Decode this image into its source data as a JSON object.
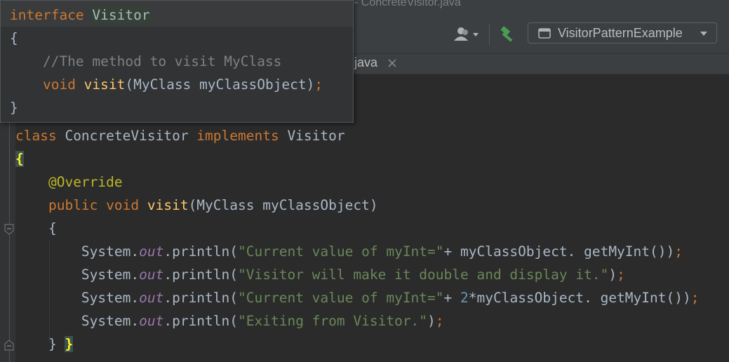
{
  "window": {
    "title_fragment": "- ConcreteVisitor.java"
  },
  "toolbar": {
    "run_config_label": "VisitorPatternExample"
  },
  "tabs": [
    {
      "label": ".java"
    }
  ],
  "popup": {
    "lines": [
      {
        "tokens": [
          {
            "t": "interface ",
            "c": "kw"
          },
          {
            "t": "Visitor",
            "c": "hl"
          }
        ]
      },
      {
        "tokens": [
          {
            "t": "{",
            "c": ""
          }
        ]
      },
      {
        "tokens": [
          {
            "t": "    //The method to visit MyClass",
            "c": "cmt"
          }
        ]
      },
      {
        "tokens": [
          {
            "t": "    ",
            "c": ""
          },
          {
            "t": "void ",
            "c": "kw"
          },
          {
            "t": "visit",
            "c": "fn"
          },
          {
            "t": "(MyClass myClassObject)",
            "c": ""
          },
          {
            "t": ";",
            "c": "kw"
          }
        ]
      },
      {
        "tokens": [
          {
            "t": "}",
            "c": ""
          }
        ]
      }
    ]
  },
  "code": {
    "lines": [
      {
        "tokens": [
          {
            "t": "class ",
            "c": "kw"
          },
          {
            "t": "ConcreteVisitor ",
            "c": ""
          },
          {
            "t": "implements ",
            "c": "kw"
          },
          {
            "t": "Visitor",
            "c": ""
          }
        ]
      },
      {
        "tokens": [
          {
            "t": "{",
            "c": "brace-hl"
          }
        ]
      },
      {
        "tokens": [
          {
            "t": "    ",
            "c": ""
          },
          {
            "t": "@Override",
            "c": "ann"
          }
        ]
      },
      {
        "tokens": [
          {
            "t": "    ",
            "c": ""
          },
          {
            "t": "public ",
            "c": "kw"
          },
          {
            "t": "void ",
            "c": "kw"
          },
          {
            "t": "visit",
            "c": "fn"
          },
          {
            "t": "(MyClass myClassObject)",
            "c": ""
          }
        ]
      },
      {
        "tokens": [
          {
            "t": "    {",
            "c": ""
          }
        ]
      },
      {
        "tokens": [
          {
            "t": "        System.",
            "c": ""
          },
          {
            "t": "out",
            "c": "fld"
          },
          {
            "t": ".println(",
            "c": ""
          },
          {
            "t": "\"Current value of myInt=\"",
            "c": "str"
          },
          {
            "t": "+ myClassObject. getMyInt())",
            "c": ""
          },
          {
            "t": ";",
            "c": "kw"
          }
        ]
      },
      {
        "tokens": [
          {
            "t": "        System.",
            "c": ""
          },
          {
            "t": "out",
            "c": "fld"
          },
          {
            "t": ".println(",
            "c": ""
          },
          {
            "t": "\"Visitor will make it double and display it.\"",
            "c": "str"
          },
          {
            "t": ")",
            "c": ""
          },
          {
            "t": ";",
            "c": "kw"
          }
        ]
      },
      {
        "tokens": [
          {
            "t": "        System.",
            "c": ""
          },
          {
            "t": "out",
            "c": "fld"
          },
          {
            "t": ".println(",
            "c": ""
          },
          {
            "t": "\"Current value of myInt=\"",
            "c": "str"
          },
          {
            "t": "+ ",
            "c": ""
          },
          {
            "t": "2",
            "c": "num"
          },
          {
            "t": "*myClassObject. getMyInt())",
            "c": ""
          },
          {
            "t": ";",
            "c": "kw"
          }
        ]
      },
      {
        "tokens": [
          {
            "t": "        System.",
            "c": ""
          },
          {
            "t": "out",
            "c": "fld"
          },
          {
            "t": ".println(",
            "c": ""
          },
          {
            "t": "\"Exiting from Visitor.\"",
            "c": "str"
          },
          {
            "t": ")",
            "c": ""
          },
          {
            "t": ";",
            "c": "kw"
          }
        ]
      },
      {
        "tokens": [
          {
            "t": "    } ",
            "c": ""
          },
          {
            "t": "}",
            "c": "brace-hl"
          }
        ]
      }
    ]
  },
  "colors": {
    "keyword": "#cc7832",
    "function": "#ffc66d",
    "string": "#6a8759",
    "number": "#6897bb",
    "annotation": "#bbb529",
    "static_field": "#9876aa",
    "comment": "#808080",
    "text": "#a9b7c6",
    "brace_match": "#ffef28"
  }
}
